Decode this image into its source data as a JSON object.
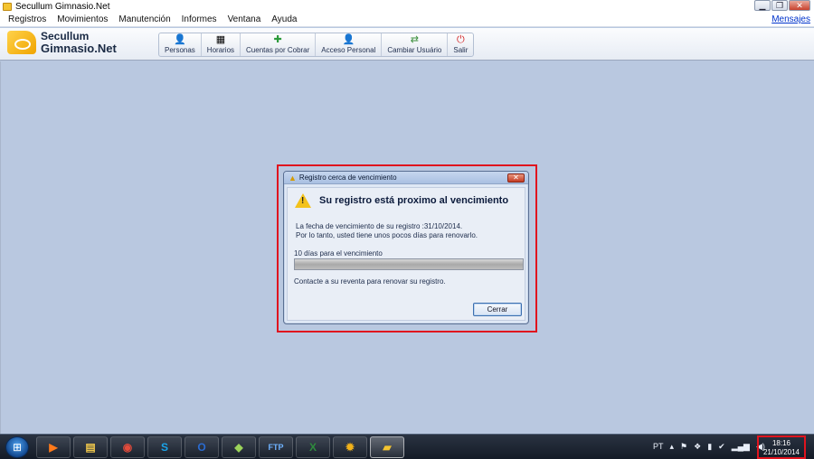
{
  "window": {
    "title": "Secullum Gimnasio.Net",
    "controls": {
      "minimize": "▁",
      "maximize": "❐",
      "close": "✕"
    }
  },
  "menubar": {
    "items": [
      "Registros",
      "Movimientos",
      "Manutención",
      "Informes",
      "Ventana",
      "Ayuda"
    ],
    "mensajes": "Mensajes"
  },
  "brand": {
    "line1": "Secullum",
    "line2": "Gimnasio.Net"
  },
  "toolbar": {
    "items": [
      {
        "label": "Personas",
        "icon": "people-icon"
      },
      {
        "label": "Horarios",
        "icon": "calendar-icon"
      },
      {
        "label": "Cuentas por Cobrar",
        "icon": "money-add-icon"
      },
      {
        "label": "Acceso Personal",
        "icon": "person-access-icon"
      },
      {
        "label": "Cambiar Usuário",
        "icon": "switch-user-icon"
      },
      {
        "label": "Salir",
        "icon": "exit-icon"
      }
    ]
  },
  "dialog": {
    "title": "Registro cerca de vencimiento",
    "close": "✕",
    "heading": "Su registro está proximo al vencimiento",
    "message_line1": "La fecha de vencimiento de su registro :31/10/2014.",
    "message_line2": "Por lo tanto, usted tiene unos pocos días para renovarlo.",
    "days_text": "10 días para el vencimiento",
    "progress": 1.0,
    "contact_text": "Contacte a su reventa para renovar su registro.",
    "close_button": "Cerrar",
    "warning_icon": "warning-icon"
  },
  "taskbar": {
    "apps": [
      {
        "name": "media-player-icon",
        "glyph": "▶",
        "color": "#ff7a1a"
      },
      {
        "name": "file-explorer-icon",
        "glyph": "▤",
        "color": "#f2c94c"
      },
      {
        "name": "chrome-icon",
        "glyph": "◉",
        "color": "#e34b3b"
      },
      {
        "name": "skype-icon",
        "glyph": "S",
        "color": "#1aa3e8"
      },
      {
        "name": "outlook-icon",
        "glyph": "O",
        "color": "#2a6bd1"
      },
      {
        "name": "folder-app-icon",
        "glyph": "◆",
        "color": "#9bd35a"
      },
      {
        "name": "ftp-icon",
        "glyph": "FTP",
        "color": "#6fb3ff"
      },
      {
        "name": "excel-icon",
        "glyph": "X",
        "color": "#2e8b3d"
      },
      {
        "name": "gear-app-icon",
        "glyph": "✹",
        "color": "#f2b21a"
      },
      {
        "name": "gimnasio-app-icon",
        "glyph": "▰",
        "color": "#f4c430"
      }
    ],
    "language": "PT",
    "clock_time": "18:16",
    "clock_date": "21/10/2014"
  }
}
